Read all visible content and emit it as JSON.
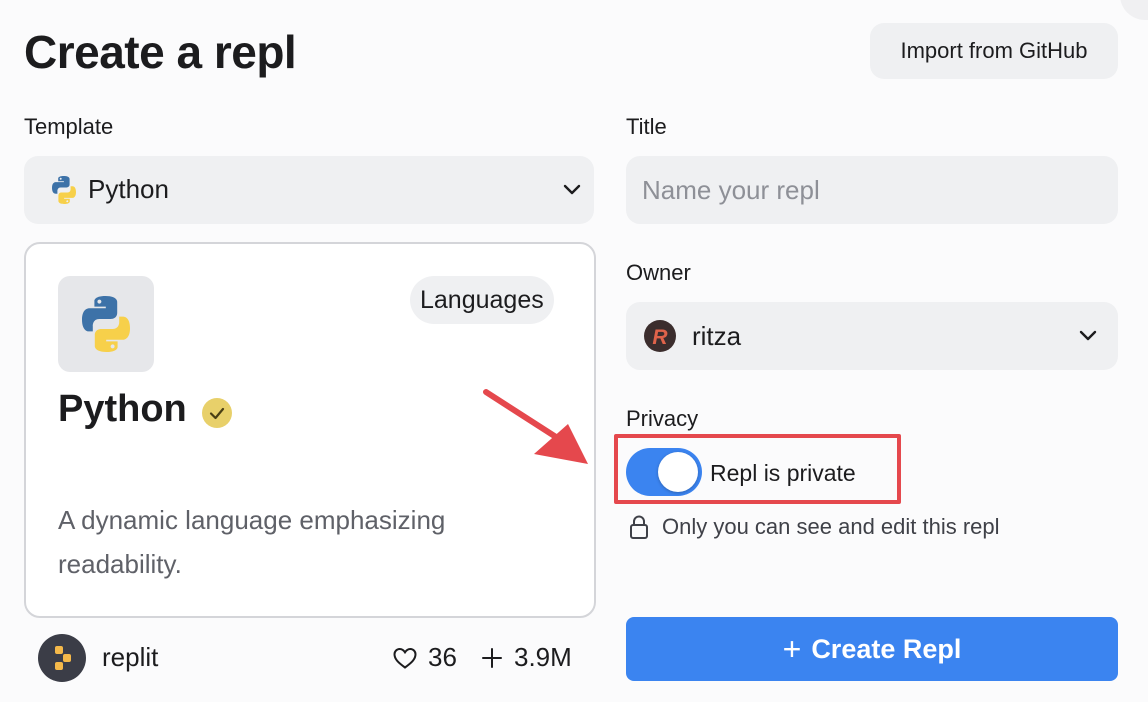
{
  "header": {
    "title": "Create a repl",
    "import_button": "Import from GitHub"
  },
  "template": {
    "label": "Template",
    "selected": "Python",
    "card": {
      "badge": "Languages",
      "name": "Python",
      "description": "A dynamic language emphasizing readability.",
      "author": "replit",
      "likes": "36",
      "forks": "3.9M"
    }
  },
  "title_field": {
    "label": "Title",
    "placeholder": "Name your repl",
    "value": ""
  },
  "owner": {
    "label": "Owner",
    "selected": "ritza",
    "avatar_letter": "R"
  },
  "privacy": {
    "label": "Privacy",
    "toggle_label": "Repl is private",
    "toggle_on": true,
    "note": "Only you can see and edit this repl"
  },
  "create_button": {
    "plus": "+",
    "label": "Create Repl"
  },
  "colors": {
    "accent": "#3b84f0",
    "annotation": "#e5484d",
    "python_blue": "#3d72a8",
    "python_yellow": "#f7d04a"
  }
}
